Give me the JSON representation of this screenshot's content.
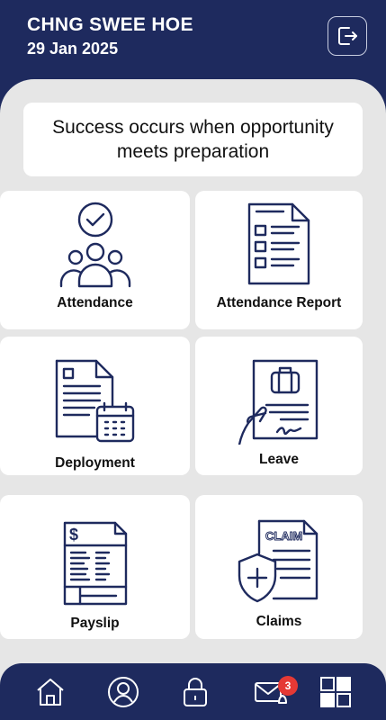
{
  "header": {
    "user_name": "CHNG SWEE HOE",
    "date": "29 Jan 2025"
  },
  "quote": "Success occurs when opportunity meets preparation",
  "tiles": [
    {
      "label": "Attendance",
      "icon": "attendance-icon"
    },
    {
      "label": "Attendance Report",
      "icon": "report-icon"
    },
    {
      "label": "Deployment",
      "icon": "deployment-icon"
    },
    {
      "label": "Leave",
      "icon": "leave-icon"
    },
    {
      "label": "Payslip",
      "icon": "payslip-icon"
    },
    {
      "label": "Claims",
      "icon": "claims-icon"
    }
  ],
  "claims_doc_text": "CLAIM",
  "payslip_symbol": "$",
  "nav": {
    "items": [
      "home-icon",
      "profile-icon",
      "lock-icon",
      "mail-bell-icon",
      "apps-icon"
    ],
    "mail_badge": "3"
  },
  "colors": {
    "primary": "#1e2a5e",
    "background": "#e6e6e6",
    "badge": "#e53935"
  }
}
